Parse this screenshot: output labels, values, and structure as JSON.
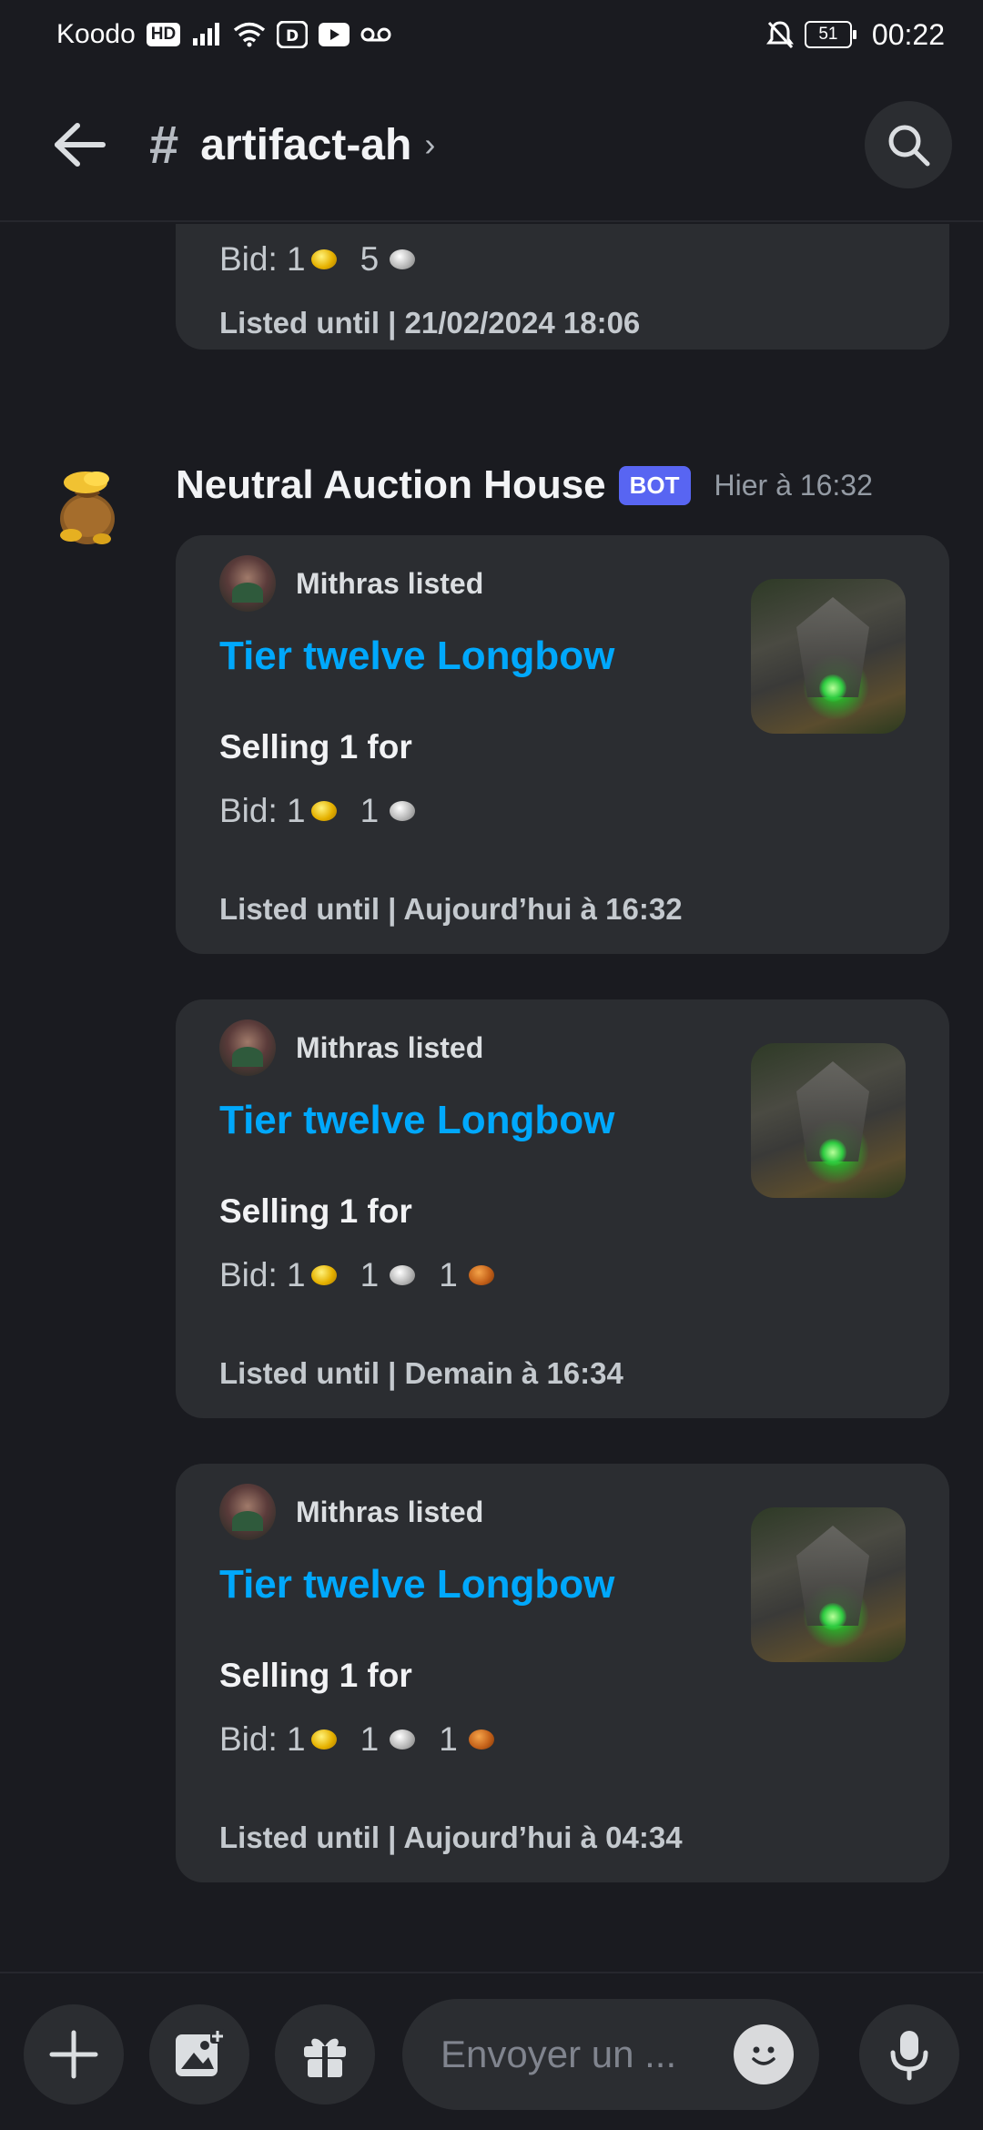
{
  "status_bar": {
    "carrier": "Koodo",
    "hd_badge": "HD",
    "battery": "51",
    "time": "00:22",
    "icons": [
      "signal-icon",
      "wifi-icon",
      "disney-icon",
      "youtube-icon",
      "voicemail-icon",
      "bell-off-icon"
    ]
  },
  "header": {
    "channel_name": "artifact-ah",
    "hash": "#",
    "chevron": "›",
    "icons": [
      "back-arrow-icon",
      "search-icon"
    ]
  },
  "partial_embed": {
    "bid_label": "Bid: 1",
    "bid_silver": "5",
    "listed_until": "Listed until | 21/02/2024 18:06"
  },
  "message": {
    "author": "Neutral Auction House",
    "badge": "BOT",
    "timestamp": "Hier à 16:32"
  },
  "embeds": [
    {
      "author": "Mithras listed",
      "title": "Tier twelve Longbow",
      "selling": "Selling 1 for",
      "bid_label": "Bid: 1",
      "silver": "1",
      "copper": "",
      "listed_until": "Listed until | Aujourd’hui à 16:32"
    },
    {
      "author": "Mithras listed",
      "title": "Tier twelve Longbow",
      "selling": "Selling 1 for",
      "bid_label": "Bid: 1",
      "silver": "1",
      "copper": "1",
      "listed_until": "Listed until | Demain à 16:34"
    },
    {
      "author": "Mithras listed",
      "title": "Tier twelve Longbow",
      "selling": "Selling 1 for",
      "bid_label": "Bid: 1",
      "silver": "1",
      "copper": "1",
      "listed_until": "Listed until | Aujourd’hui à 04:34"
    }
  ],
  "composer": {
    "placeholder": "Envoyer un ..."
  },
  "colors": {
    "background": "#1a1b20",
    "embed": "#2b2d31",
    "link": "#00a8fc",
    "bot_badge": "#5865f2"
  }
}
